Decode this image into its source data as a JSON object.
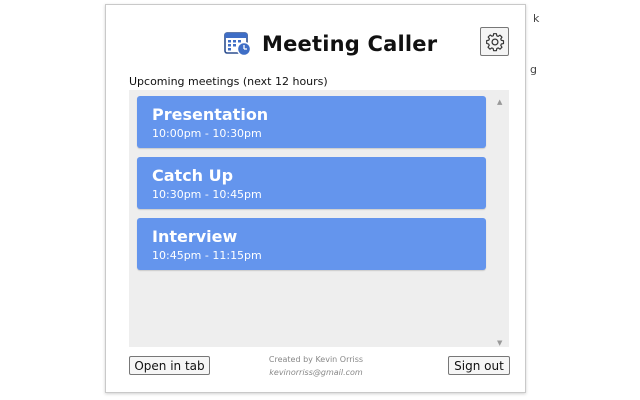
{
  "background_fragments": [
    "k",
    "g"
  ],
  "header": {
    "title": "Meeting Caller",
    "calendar_icon": "calendar-clock-icon",
    "settings_icon": "gear-icon"
  },
  "subtitle": "Upcoming meetings (next 12 hours)",
  "meetings": [
    {
      "title": "Presentation",
      "time": "10:00pm - 10:30pm"
    },
    {
      "title": "Catch Up",
      "time": "10:30pm - 10:45pm"
    },
    {
      "title": "Interview",
      "time": "10:45pm - 11:15pm"
    }
  ],
  "footer": {
    "open_tab_label": "Open in tab",
    "sign_out_label": "Sign out",
    "credit_line": "Created by Kevin Orriss",
    "credit_email": "kevinorriss@gmail.com"
  },
  "colors": {
    "meeting_card": "#6495ed",
    "list_background": "#eeeeee",
    "calendar_icon_blue": "#3f6ec6"
  }
}
